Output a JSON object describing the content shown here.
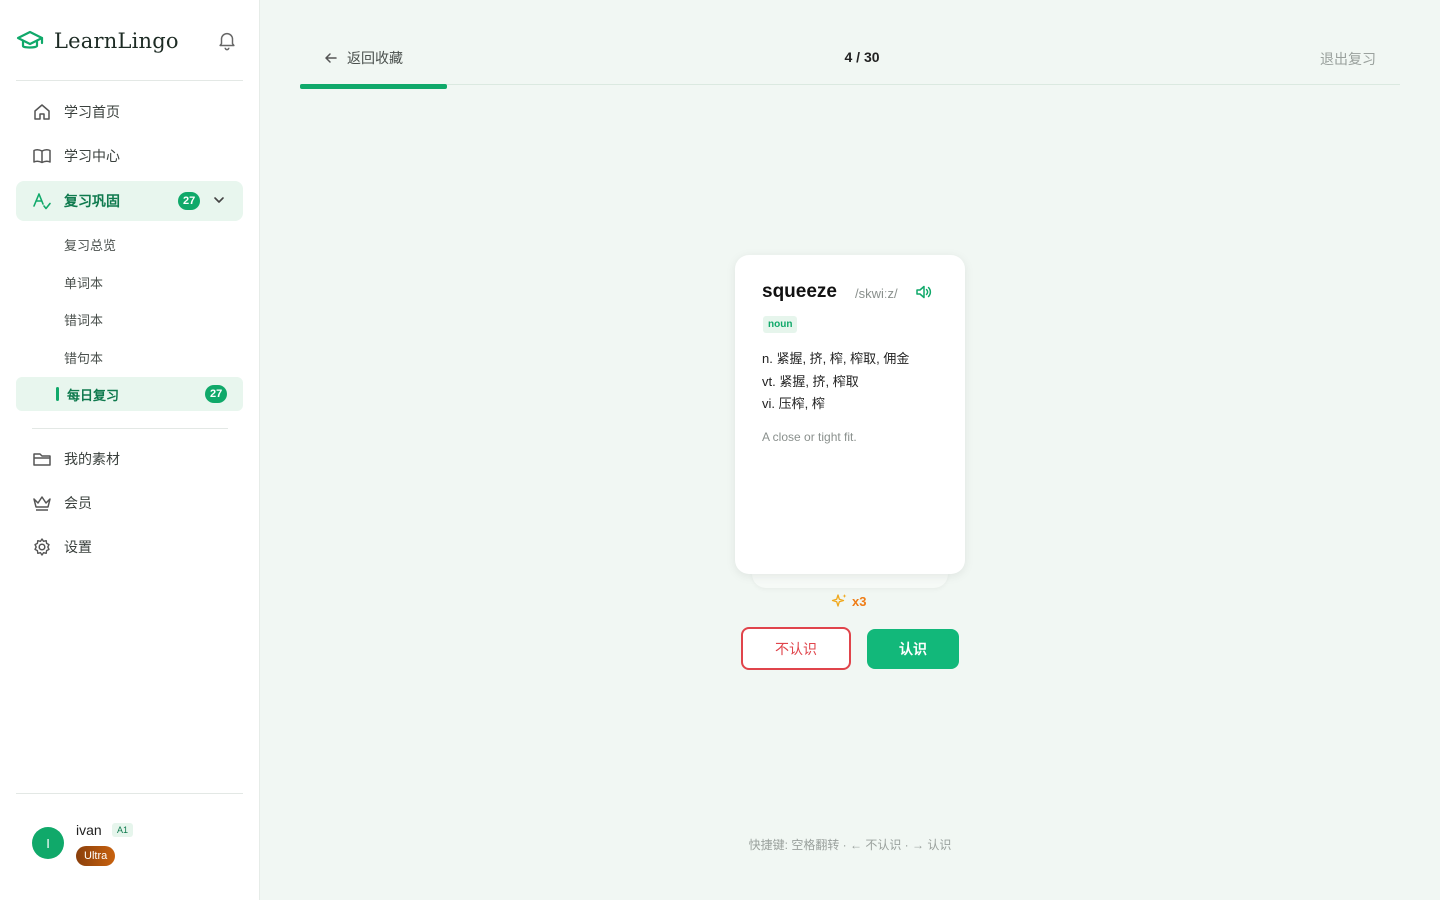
{
  "app": {
    "name": "LearnLingo",
    "accent": "#10a96a"
  },
  "sidebar": {
    "items": [
      {
        "label": "学习首页",
        "icon": "home-icon"
      },
      {
        "label": "学习中心",
        "icon": "book-icon"
      },
      {
        "label": "复习巩固",
        "icon": "review-icon",
        "badge": "27",
        "expanded": true
      },
      {
        "label": "我的素材",
        "icon": "folder-icon"
      },
      {
        "label": "会员",
        "icon": "crown-icon"
      },
      {
        "label": "设置",
        "icon": "gear-icon"
      }
    ],
    "sub_items": [
      {
        "label": "复习总览"
      },
      {
        "label": "单词本"
      },
      {
        "label": "错词本"
      },
      {
        "label": "错句本"
      },
      {
        "label": "每日复习",
        "badge": "27",
        "active": true
      }
    ]
  },
  "user": {
    "initial": "I",
    "name": "ivan",
    "level": "A1",
    "plan": "Ultra"
  },
  "header": {
    "back_label": "返回收藏",
    "progress_text": "4 / 30",
    "progress_current": 4,
    "progress_total": 30,
    "exit_label": "退出复习"
  },
  "card": {
    "word": "squeeze",
    "phonetic": "/skwiːz/",
    "pos": "noun",
    "definitions": [
      "n. 紧握, 挤, 榨, 榨取, 佣金",
      "vt. 紧握, 挤, 榨取",
      "vi. 压榨, 榨"
    ],
    "example": "A close or tight fit."
  },
  "streak": {
    "text": "x3"
  },
  "actions": {
    "unknown_label": "不认识",
    "known_label": "认识"
  },
  "shortcuts": "快捷键: 空格翻转 · ← 不认识 · → 认识"
}
